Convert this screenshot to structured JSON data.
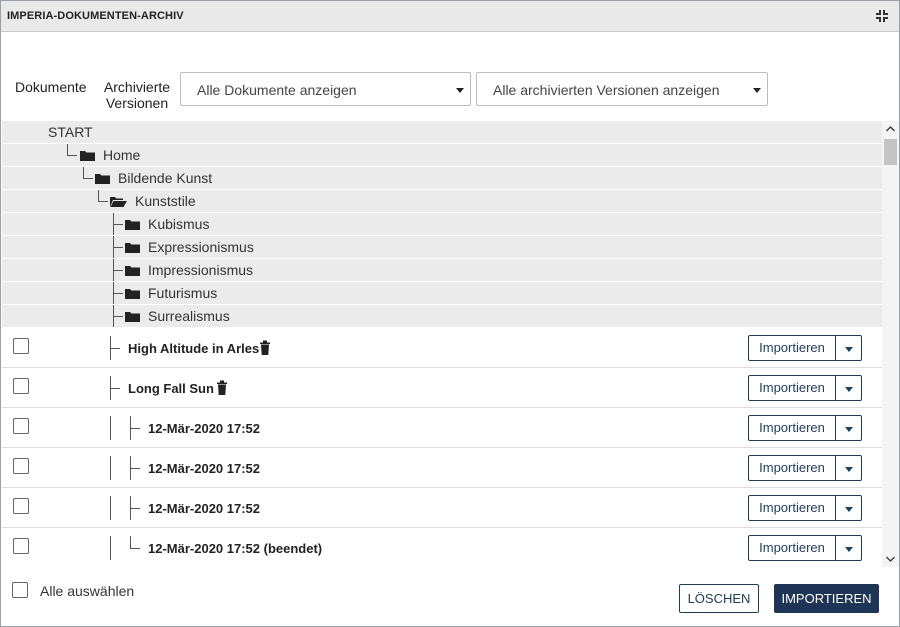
{
  "window": {
    "title": "IMPERIA-DOKUMENTEN-ARCHIV"
  },
  "filters": {
    "documents_label": "Dokumente",
    "archived_label_line1": "Archivierte",
    "archived_label_line2": "Versionen",
    "documents_select": "Alle Dokumente anzeigen",
    "versions_select": "Alle archivierten Versionen anzeigen"
  },
  "tree": {
    "root": "START",
    "folders": {
      "home": "Home",
      "bildende_kunst": "Bildende Kunst",
      "kunststile": "Kunststile",
      "kubismus": "Kubismus",
      "expressionismus": "Expressionismus",
      "impressionismus": "Impressionismus",
      "futurismus": "Futurismus",
      "surrealismus": "Surrealismus"
    }
  },
  "documents": [
    {
      "name": "High Altitude in Arles",
      "action": "Importieren"
    },
    {
      "name": "Long Fall Sun",
      "action": "Importieren"
    },
    {
      "name": "12-Mär-2020 17:52",
      "action": "Importieren"
    },
    {
      "name": "12-Mär-2020 17:52",
      "action": "Importieren"
    },
    {
      "name": "12-Mär-2020 17:52",
      "action": "Importieren"
    },
    {
      "name": "12-Mär-2020 17:52 (beendet)",
      "action": "Importieren"
    }
  ],
  "footer": {
    "select_all": "Alle auswählen",
    "delete": "LÖSCHEN",
    "import": "IMPORTIEREN"
  },
  "colors": {
    "primary": "#1e3557",
    "row_bg": "#ebebeb",
    "titlebar_bg": "#e9e9e9"
  }
}
